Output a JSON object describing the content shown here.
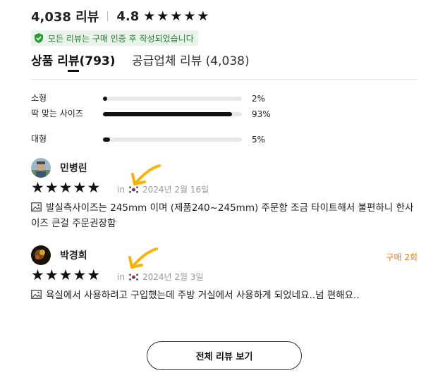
{
  "summary": {
    "review_count": "4,038 리뷰",
    "score": "4.8",
    "stars": 5
  },
  "verified_text": "모든 리뷰는 구매 인증 후 작성되었습니다",
  "tabs": [
    {
      "label": "상품 리뷰(793)",
      "active": true
    },
    {
      "label": "공급업체 리뷰 (4,038)",
      "active": false
    }
  ],
  "fit": [
    {
      "label": "소형",
      "percent": 2,
      "value_text": "2%"
    },
    {
      "label": "딱 맞는 사이즈",
      "percent": 93,
      "value_text": "93%"
    },
    {
      "label": "대형",
      "percent": 5,
      "value_text": "5%"
    }
  ],
  "reviews": [
    {
      "name": "민병린",
      "stars": 5,
      "in": "in",
      "date": "2024년 2월 16일",
      "text": "발실측사이즈는 245mm 이며 (제품240~245mm) 주문함 조금 타이트해서 불편하니 한사이즈 큰걸 주문권장함",
      "purchase": ""
    },
    {
      "name": "박경희",
      "stars": 5,
      "in": "in",
      "date": "2024년 2월 3일",
      "text": "욕실에서 사용하려고 구입했는데 주방 거실에서 사용하게 되었네요..넘 편해요..",
      "purchase": "구매 2회"
    }
  ],
  "all_reviews_button": "전체 리뷰 보기",
  "colors": {
    "accent_orange": "#e07b1a",
    "verified_green": "#2a7d32",
    "bar_fill": "#111111",
    "annotation_arrow": "#f5b400"
  },
  "icons": [
    "star-icon",
    "shield-check-icon",
    "image-icon",
    "korea-flag-icon"
  ]
}
